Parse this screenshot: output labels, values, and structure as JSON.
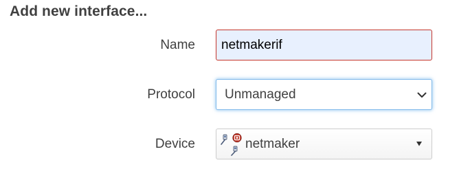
{
  "dialog": {
    "title": "Add new interface..."
  },
  "form": {
    "name": {
      "label": "Name",
      "value": "netmakerif"
    },
    "protocol": {
      "label": "Protocol",
      "selected": "Unmanaged"
    },
    "device": {
      "label": "Device",
      "selected": "netmaker",
      "icon": "network-device-disabled-icon"
    }
  },
  "colors": {
    "text": "#404040",
    "invalid_border": "#c4352b",
    "autofill_background": "#e8f0fe",
    "focus_border": "#7fb8ea",
    "disabled_badge": "#c0392b"
  }
}
